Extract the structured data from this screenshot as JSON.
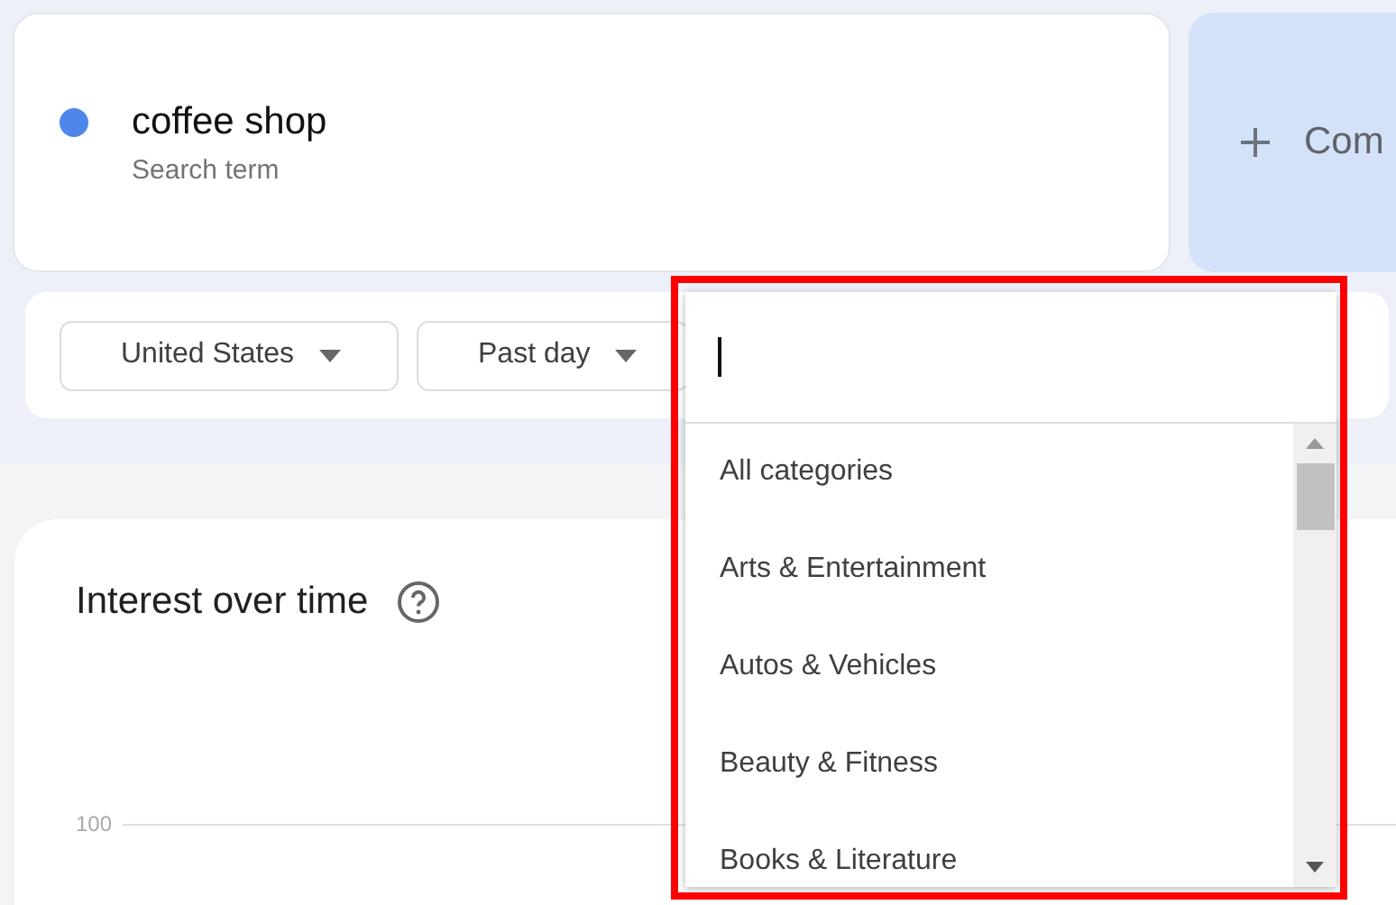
{
  "search_term": {
    "name": "coffee shop",
    "caption": "Search term",
    "color": "#4f86ec"
  },
  "compare": {
    "label": "Com"
  },
  "filters": [
    {
      "label": "United States"
    },
    {
      "label": "Past day"
    }
  ],
  "category_dropdown": {
    "items": [
      {
        "label": "All categories"
      },
      {
        "label": "Arts & Entertainment"
      },
      {
        "label": "Autos & Vehicles"
      },
      {
        "label": "Beauty & Fitness"
      },
      {
        "label": "Books & Literature"
      }
    ]
  },
  "chart": {
    "title": "Interest over time",
    "y_tick": "100"
  }
}
